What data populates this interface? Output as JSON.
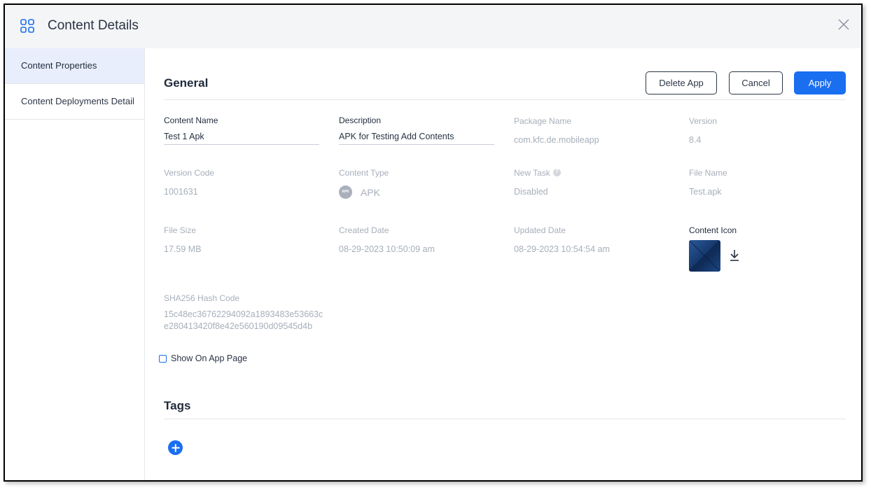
{
  "header": {
    "title": "Content Details",
    "grid_icon": "grid-icon",
    "close_icon": "close-icon"
  },
  "sidebar": {
    "items": [
      {
        "label": "Content Properties",
        "active": true
      },
      {
        "label": "Content Deployments Detail",
        "active": false
      }
    ]
  },
  "general": {
    "title": "General",
    "buttons": {
      "delete": "Delete App",
      "cancel": "Cancel",
      "apply": "Apply"
    },
    "fields": {
      "content_name": {
        "label": "Content Name",
        "value": "Test 1 Apk"
      },
      "description": {
        "label": "Description",
        "value": "APK for Testing Add Contents"
      },
      "package_name": {
        "label": "Package Name",
        "value": "com.kfc.de.mobileapp"
      },
      "version": {
        "label": "Version",
        "value": "8.4"
      },
      "version_code": {
        "label": "Version Code",
        "value": "1001631"
      },
      "content_type": {
        "label": "Content Type",
        "value": "APK",
        "badge": "APK"
      },
      "new_task": {
        "label": "New Task",
        "value": "Disabled"
      },
      "file_name": {
        "label": "File Name",
        "value": "Test.apk"
      },
      "file_size": {
        "label": "File Size",
        "value": "17.59 MB"
      },
      "created_date": {
        "label": "Created Date",
        "value": "08-29-2023 10:50:09 am"
      },
      "updated_date": {
        "label": "Updated Date",
        "value": "08-29-2023 10:54:54 am"
      },
      "content_icon": {
        "label": "Content Icon"
      },
      "sha256": {
        "label": "SHA256 Hash Code",
        "line1": "15c48ec36762294092a1893483e53663c",
        "line2": "e280413420f8e42e560190d09545d4b"
      }
    },
    "show_on_app_page": {
      "label": "Show On App Page",
      "checked": false
    }
  },
  "tags": {
    "title": "Tags"
  },
  "colors": {
    "accent": "#1a6ef0",
    "active_sidebar": "#e8eefb",
    "header_bg": "#f4f5f7"
  }
}
